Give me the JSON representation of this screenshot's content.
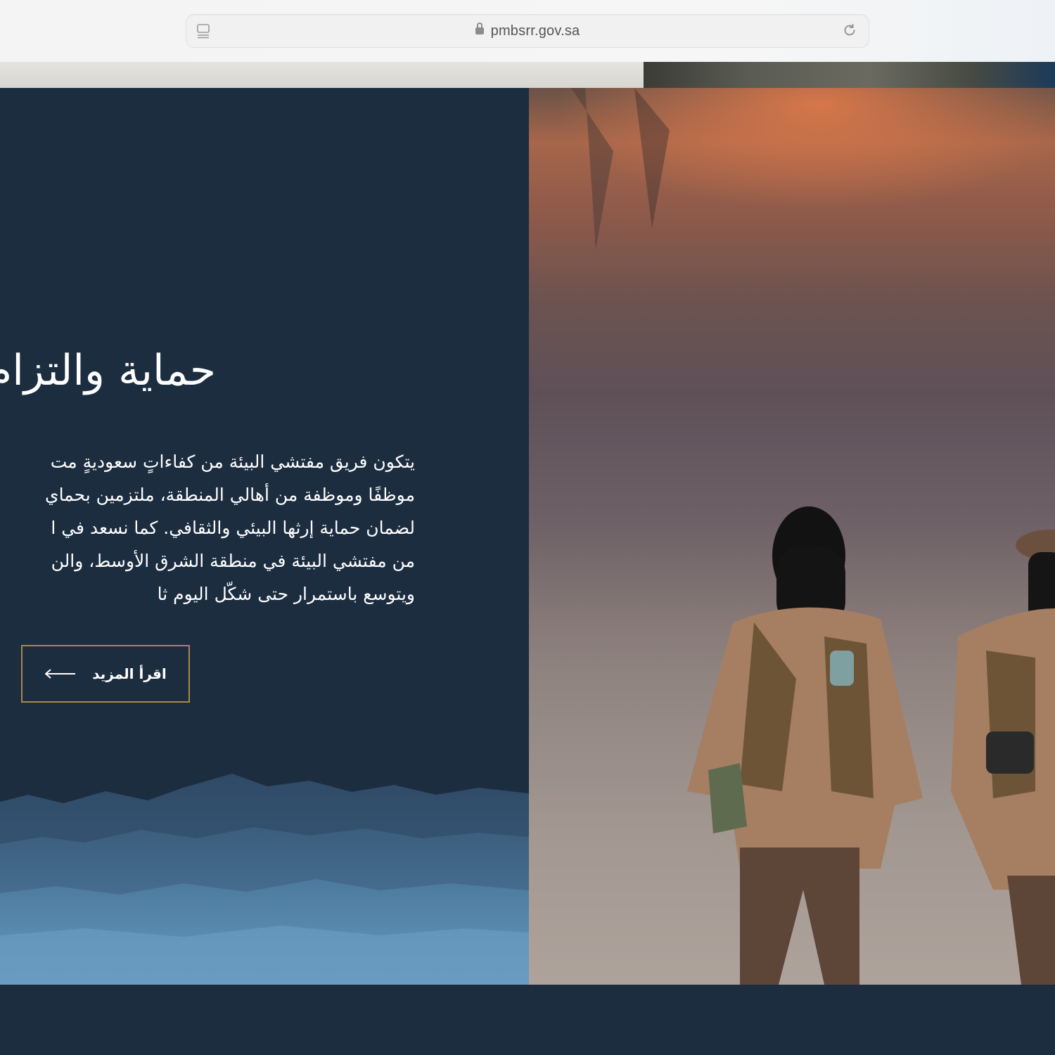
{
  "browser": {
    "url": "pmbsrr.gov.sa"
  },
  "hero": {
    "heading": "حماية والتزام",
    "paragraph_lines": [
      "يتكون فريق مفتشي البيئة من كفاءاتٍ سعوديةٍ مت",
      "موظفًا وموظفة من أهالي المنطقة، ملتزمين بحماي",
      "لضمان حماية إرثها البيئي والثقافي. كما نسعد في ا",
      "من مفتشي البيئة في منطقة الشرق الأوسط، والن",
      "ويتوسع باستمرار حتى شكّل اليوم ثا"
    ],
    "read_more_label": "اقرأ المزيد"
  },
  "colors": {
    "panel_bg": "#1c2d40",
    "button_border": "#a8884e",
    "text": "#ffffff"
  },
  "icons": {
    "tabs": "tab-overview-icon",
    "lock": "lock-icon",
    "reload": "reload-icon",
    "arrow": "arrow-left-icon"
  }
}
